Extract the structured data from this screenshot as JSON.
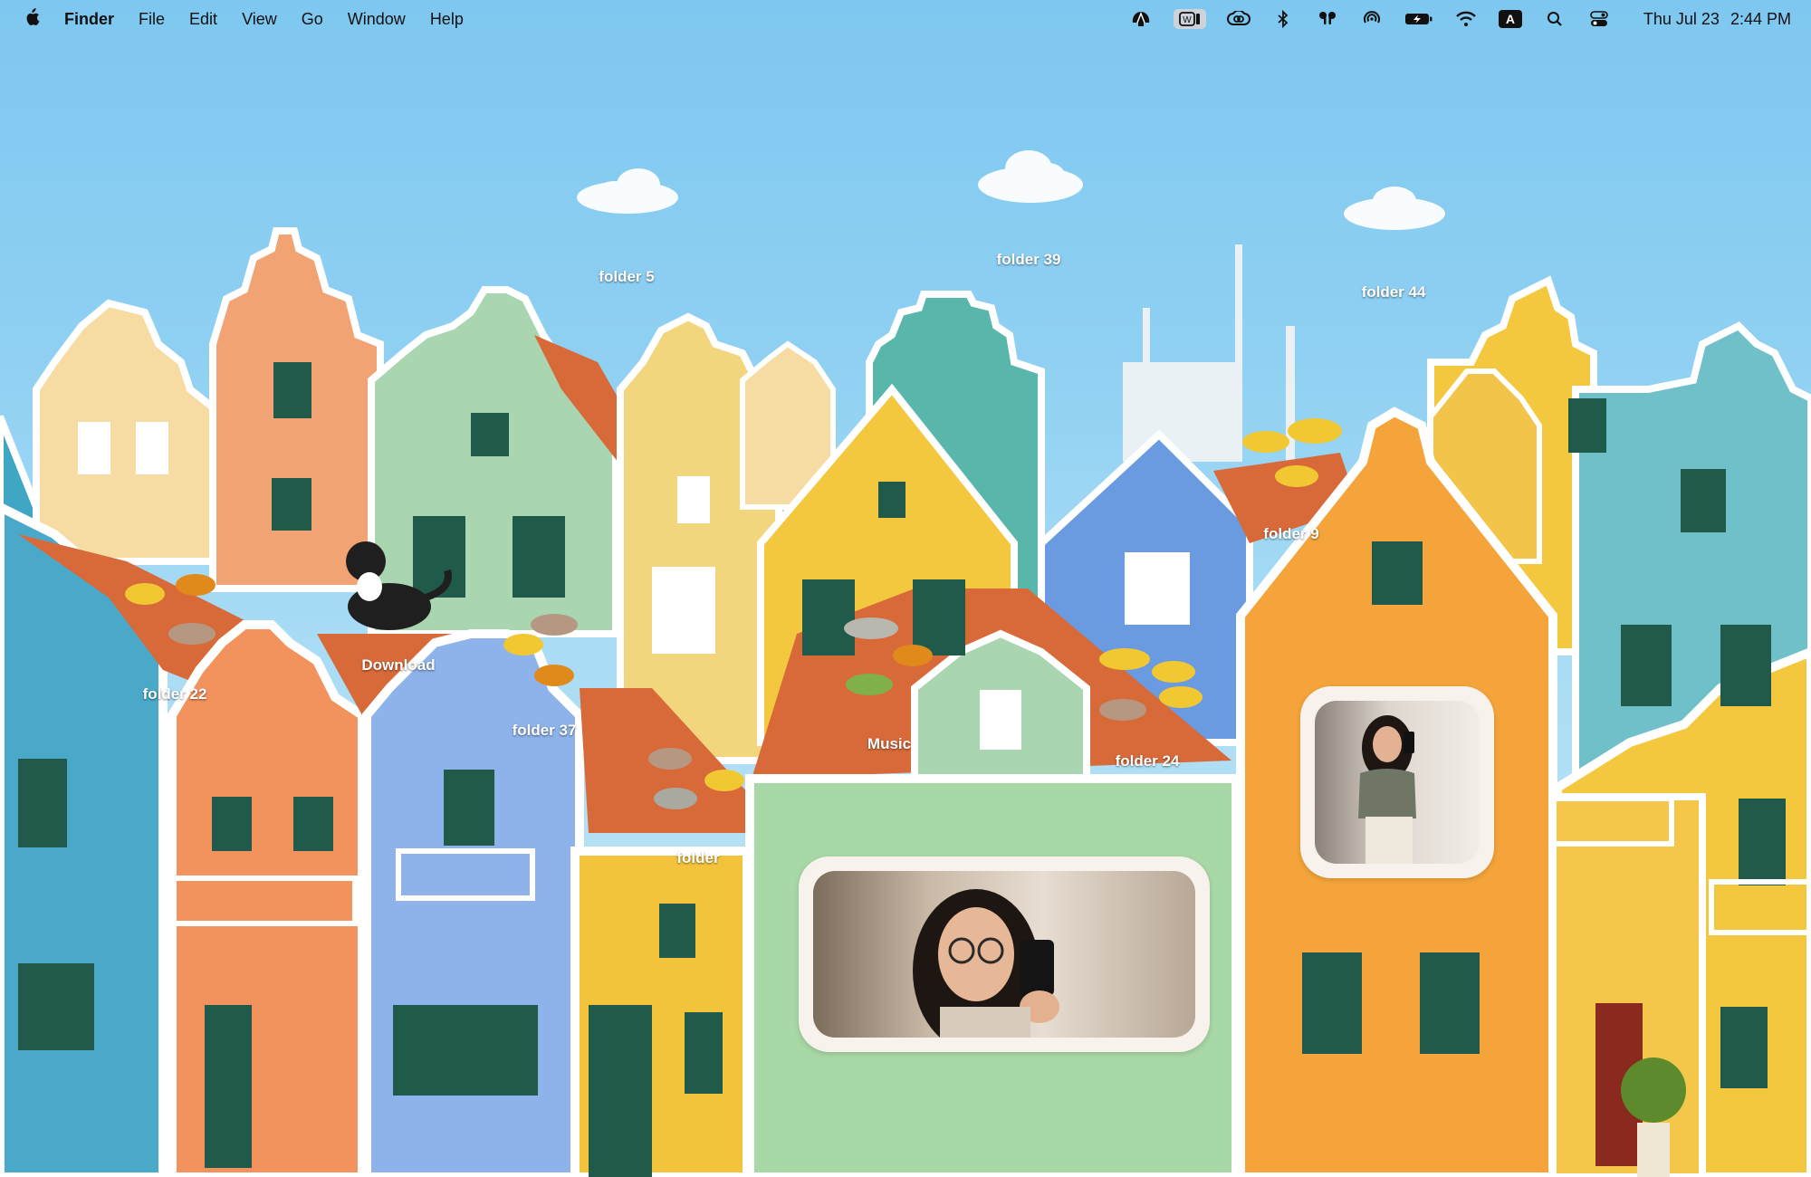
{
  "menubar": {
    "apple_icon": "apple-logo-icon",
    "app_name": "Finder",
    "menus": [
      "File",
      "Edit",
      "View",
      "Go",
      "Window",
      "Help"
    ],
    "status_icons": [
      "shell-icon",
      "word-widget-icon",
      "creative-cloud-icon",
      "bluetooth-icon",
      "airpods-icon",
      "airdrop-icon",
      "battery-charging-icon",
      "wifi-icon",
      "input-source-icon",
      "search-icon",
      "control-center-icon"
    ],
    "input_source_letter": "A",
    "clock_day": "Thu Jul 23",
    "clock_time": "2:44 PM"
  },
  "desktop_items": [
    {
      "label": "folder 5"
    },
    {
      "label": "folder 39"
    },
    {
      "label": "folder 44"
    },
    {
      "label": "folder 9"
    },
    {
      "label": "Download"
    },
    {
      "label": "folder 22"
    },
    {
      "label": "folder 37"
    },
    {
      "label": "Music"
    },
    {
      "label": "folder 24"
    },
    {
      "label": "folder"
    }
  ],
  "widgets": [
    {
      "name": "photo-widget-large",
      "content": "selfie photo"
    },
    {
      "name": "photo-widget-small",
      "content": "mirror selfie photo"
    }
  ],
  "colors": {
    "sky": "#8fd0f2",
    "teal_house": "#3fa6c4",
    "peach_house": "#f2a374",
    "mint_house": "#a9d6b0",
    "yellow_house": "#f3c83e",
    "orange_house": "#f4a43a",
    "blue_house": "#8db3ea",
    "roof": "#d86a3a",
    "shutter": "#1f5a4a"
  }
}
